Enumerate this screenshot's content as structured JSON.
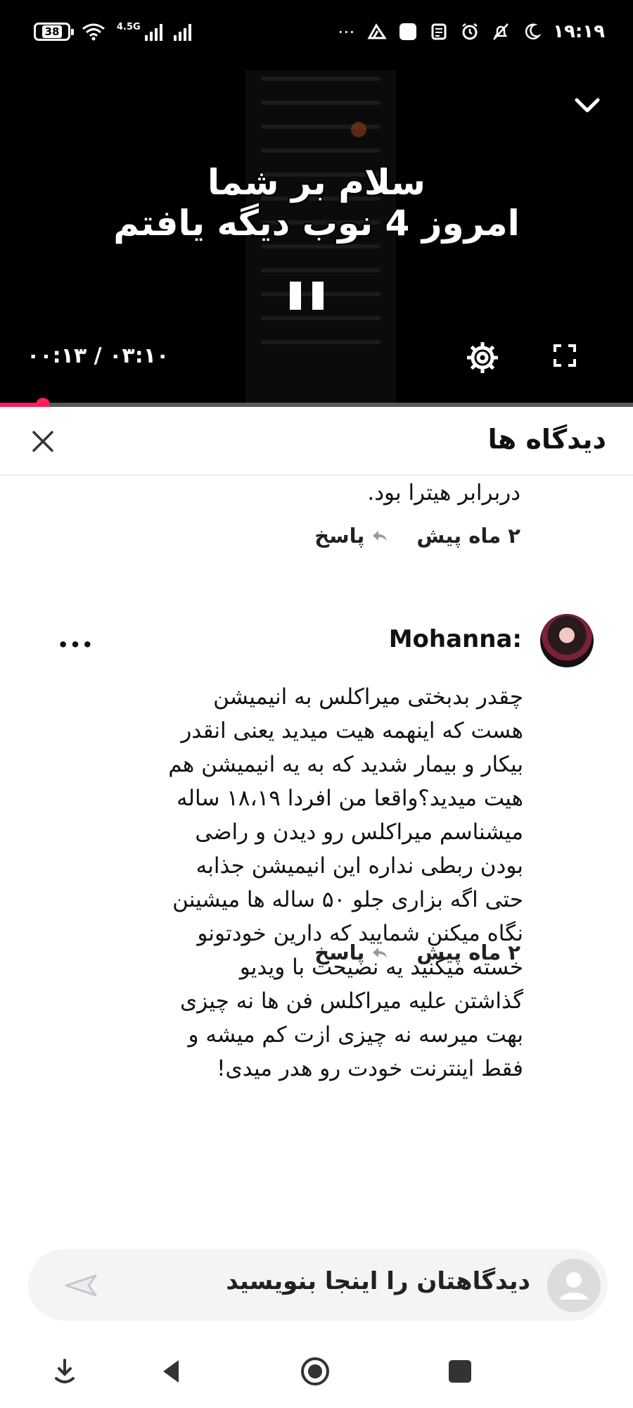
{
  "status_bar": {
    "battery": "38",
    "network_type": "4.5G",
    "time": "۱۹:۱۹",
    "overflow_icon": "more-dots-icon",
    "icons": [
      "wifi-icon",
      "signal-icon",
      "signal-icon",
      "drive-icon",
      "app-icon",
      "notes-icon",
      "alarm-icon",
      "mute-icon",
      "moon-icon"
    ]
  },
  "player": {
    "caption_line1": "سلام بر شما",
    "caption_line2": "امروز 4 نوب دیگه یافتم",
    "time": "۰۰:۱۳ / ۰۳:۱۰",
    "progress_fraction": 0.068,
    "accent_color": "#ff1e5a",
    "icons": [
      "chevron-down-icon",
      "pause-icon",
      "gear-icon",
      "fullscreen-icon"
    ]
  },
  "comments": {
    "title": "دیدگاه ها",
    "close_icon": "close-icon",
    "previous": {
      "text_tail": "دربرابر هیترا بود.",
      "time_ago": "۲ ماه پیش",
      "reply_label": "پاسخ"
    },
    "items": [
      {
        "author": "Mohanna:",
        "text": "چقدر بدبختی میراکلس به انیمیشن\nهست که اینهمه هیت میدید یعنی انقدر\nبیکار و بیمار شدید که به یه انیمیشن هم\nهیت میدید؟واقعا من افردا ۱۸،۱۹ ساله\nمیشناسم میراکلس رو دیدن و راضی\nبودن ربطی نداره این انیمیشن جذابه\nحتی اگه بزاری جلو ۵۰ ساله ها میشینن\nنگاه میکنن شمایید که دارین خودتونو\nخسته میکنید یه نصیحت با ویدیو\nگذاشتن علیه میراکلس فن ها نه چیزی\nبهت میرسه نه چیزی ازت کم میشه و\nفقط اینترنت خودت رو هدر میدی!",
        "time_ago": "۲ ماه پیش",
        "reply_label": "پاسخ"
      }
    ]
  },
  "composer": {
    "placeholder": "دیدگاهتان را اینجا بنویسید",
    "send_icon": "send-icon",
    "avatar_icon": "user-avatar-icon"
  },
  "nav_bar": {
    "icons": [
      "assistant-icon",
      "back-icon",
      "home-icon",
      "recents-icon"
    ]
  }
}
